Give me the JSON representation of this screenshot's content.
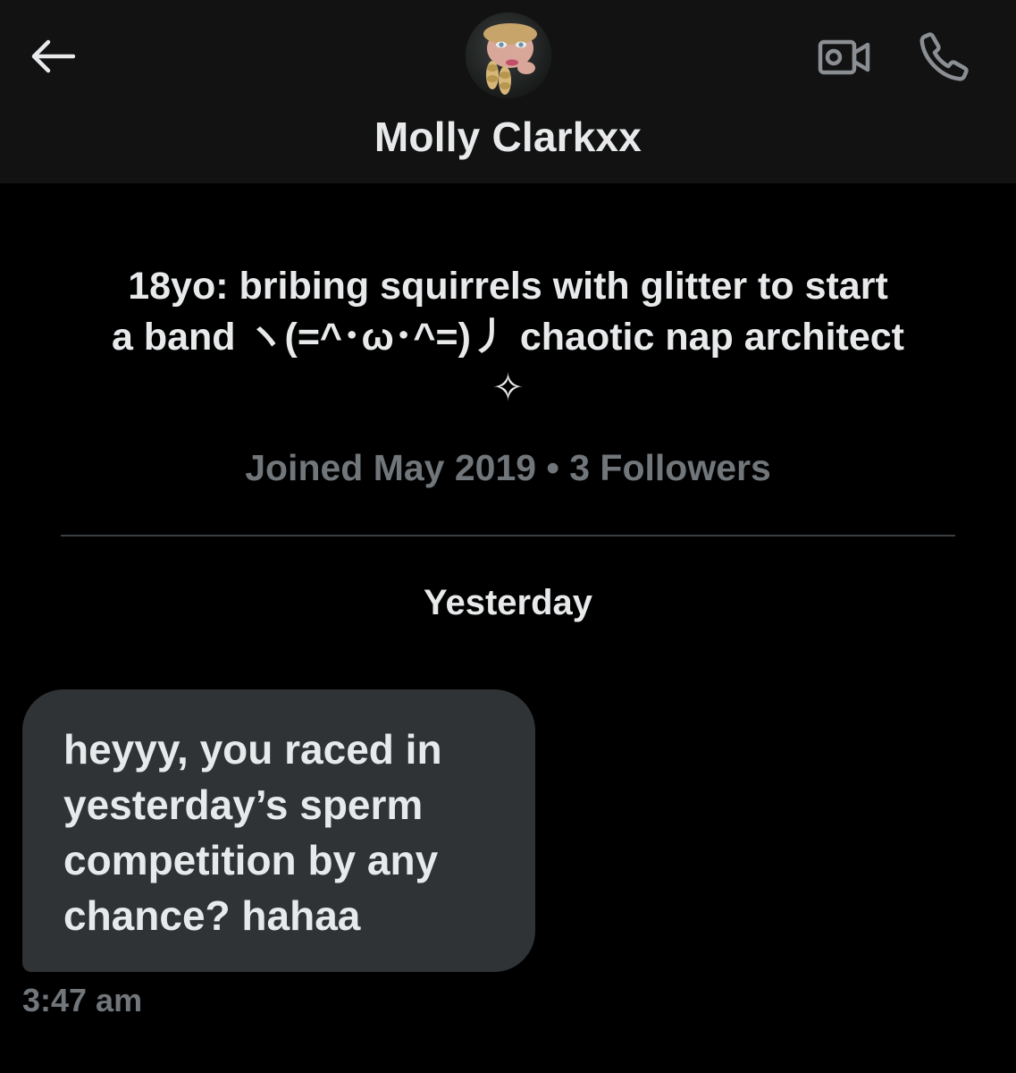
{
  "header": {
    "display_name": "Molly Clarkxx",
    "avatar_alt": "profile photo",
    "back_icon": "arrow-left-icon",
    "video_icon": "video-call-icon",
    "call_icon": "phone-icon"
  },
  "profile": {
    "bio_lines": [
      "18yo: bribing squirrels with glitter to start",
      "a band ヽ(=^･ω･^=)丿 chaotic nap architect",
      "✧"
    ],
    "meta": "Joined May 2019 • 3 Followers"
  },
  "conversation": {
    "date_separator": "Yesterday",
    "messages": [
      {
        "lines": [
          "heyyy, you raced in",
          "yesterday’s sperm",
          "competition by any",
          "chance? hahaa"
        ],
        "time": "3:47 am"
      }
    ]
  },
  "colors": {
    "background": "#000000",
    "header_bg": "#121212",
    "bubble_bg": "#2f3336",
    "text_primary": "#e7e9ea",
    "text_secondary": "#71767b",
    "icon_gray": "#8b8f93"
  }
}
